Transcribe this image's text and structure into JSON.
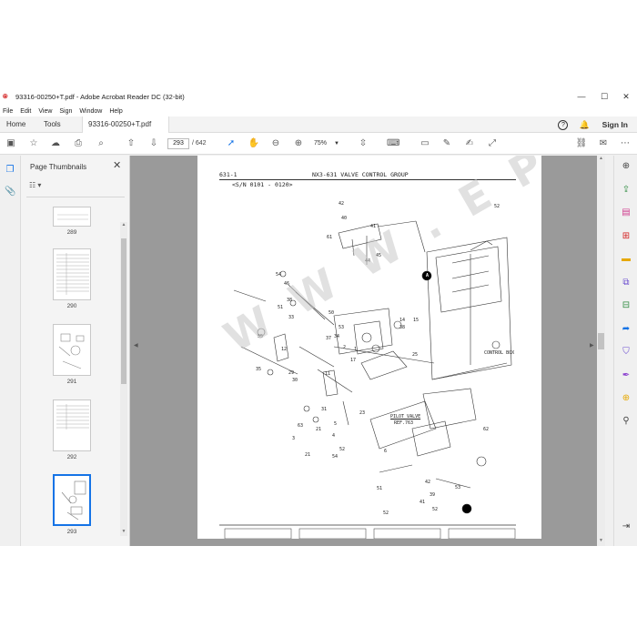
{
  "window": {
    "title": "93316-00250+T.pdf - Adobe Acrobat Reader DC (32-bit)",
    "minimize_glyph": "—",
    "maximize_glyph": "☐",
    "close_glyph": "✕"
  },
  "menu": [
    "File",
    "Edit",
    "View",
    "Sign",
    "Window",
    "Help"
  ],
  "tabs": {
    "home": "Home",
    "tools": "Tools",
    "document": "93316-00250+T.pdf",
    "close_glyph": "×",
    "help_glyph": "?",
    "signin": "Sign In"
  },
  "toolbar": {
    "current_page": "293",
    "page_count": "/ 642",
    "zoom": "75%"
  },
  "thumbnail_panel": {
    "title": "Page Thumbnails",
    "close_glyph": "✕",
    "thumbnails": [
      {
        "label": "289"
      },
      {
        "label": "290"
      },
      {
        "label": "291"
      },
      {
        "label": "292"
      },
      {
        "label": "293"
      }
    ]
  },
  "document": {
    "page_id": "631-1",
    "group_title": "NX3-631   VALVE CONTROL GROUP",
    "serial_range": "<S/N 0101 - 0120>",
    "labels": {
      "control_box": "CONTROL BOX",
      "pilot_valve": "PILOT VALVE",
      "ref": "REF.763"
    },
    "watermark": "WWW.EPCDEPO.COM",
    "callouts": [
      "42",
      "41",
      "40",
      "61",
      "45",
      "44",
      "52",
      "54",
      "46",
      "51",
      "38",
      "33",
      "50",
      "53",
      "34",
      "37",
      "55",
      "12",
      "11",
      "35",
      "29",
      "30",
      "31",
      "5",
      "4",
      "52",
      "54",
      "21",
      "63",
      "3",
      "2",
      "1",
      "17",
      "14",
      "15",
      "38",
      "25",
      "23",
      "21",
      "6",
      "39",
      "41",
      "42",
      "53",
      "52",
      "51",
      "52",
      "62",
      "A"
    ]
  },
  "colors": {
    "accent": "#1473e6",
    "doc_background": "#9a9a9a",
    "pdf_icon": "#d32020"
  },
  "icons": {
    "right_rail": [
      "zoom-in-icon",
      "export-pdf-icon",
      "organize-pages-icon",
      "create-pdf-icon",
      "comment-icon",
      "combine-files-icon",
      "edit-pdf-icon",
      "send-icon",
      "protect-icon",
      "fill-sign-icon",
      "more-tools-icon",
      "pin-icon"
    ]
  }
}
